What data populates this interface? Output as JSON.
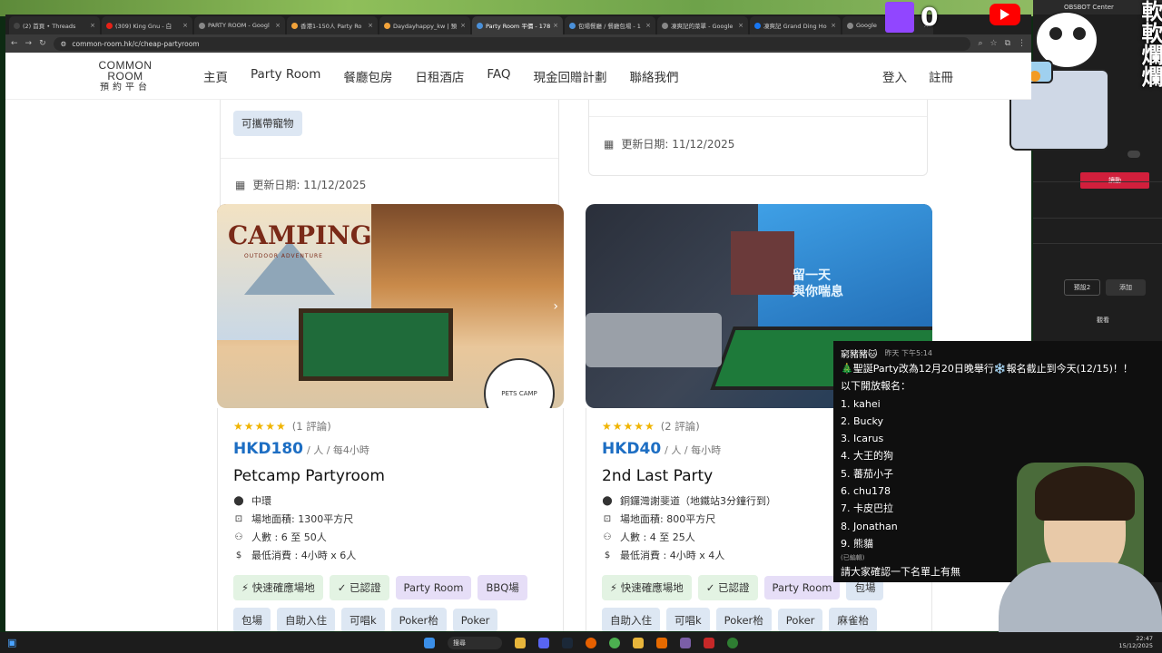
{
  "browser": {
    "tabs": [
      {
        "label": "(2) 首頁 • Threads",
        "color": "#444"
      },
      {
        "label": "(309) King Gnu - 白",
        "color": "#e62117"
      },
      {
        "label": "PARTY ROOM - Googl",
        "color": "#888"
      },
      {
        "label": "香港1-150人 Party Ro",
        "color": "#f2a33a"
      },
      {
        "label": "Daydayhappy_kw | 預",
        "color": "#f2a33a"
      },
      {
        "label": "Party Room 平價 - 178",
        "color": "#4a90d9"
      },
      {
        "label": "包場餐廳 / 餐廳包場 - 1",
        "color": "#4a90d9"
      },
      {
        "label": "凍爽記的菜單 - Google",
        "color": "#888"
      },
      {
        "label": "凍爽記 Grand Ding Ho",
        "color": "#1877f2"
      },
      {
        "label": "Google",
        "color": "#888"
      }
    ],
    "url": "common-room.hk/c/cheap-partyroom"
  },
  "site": {
    "logo_top": "COMMON ROOM",
    "logo_bottom": "預約平台",
    "menu": [
      "主頁",
      "Party Room",
      "餐廳包房",
      "日租酒店",
      "FAQ",
      "現金回贈計劃",
      "聯絡我們"
    ],
    "login": "登入",
    "register": "註冊"
  },
  "prev_cards": {
    "left_tag": "可攜帶寵物",
    "left_updated": "更新日期: 11/12/2025",
    "right_updated": "更新日期: 11/12/2025"
  },
  "cards": [
    {
      "image_text": "CAMPING",
      "image_subtext": "OUTDOOR ADVENTURE",
      "badge": "PETS CAMP",
      "stars": "★★★★★",
      "reviews": "(1 評論)",
      "price": "HKD180",
      "per": "/ 人 / 每4小時",
      "title": "Petcamp Partyroom",
      "location": "中環",
      "area": "場地面積: 1300平方尺",
      "people": "人數 : 6 至 50人",
      "min_spend": "最低消費 : 4小時 x 6人",
      "tags_row1": [
        {
          "label": "⚡ 快速確應場地",
          "style": "green"
        },
        {
          "label": "✓ 已認證",
          "style": "green"
        },
        {
          "label": "Party Room",
          "style": "purple"
        },
        {
          "label": "BBQ場",
          "style": "purple"
        }
      ],
      "tags_row2": [
        {
          "label": "包場",
          "style": "blue"
        },
        {
          "label": "自助入住",
          "style": "blue"
        },
        {
          "label": "可唱k",
          "style": "blue"
        },
        {
          "label": "Poker枱",
          "style": "blue"
        },
        {
          "label": "Poker",
          "style": "blue"
        }
      ]
    },
    {
      "image_text": "留一天 與你喘息",
      "stars": "★★★★★",
      "reviews": "(2 評論)",
      "price": "HKD40",
      "per": "/ 人 / 每小時",
      "title": "2nd Last Party",
      "location": "銅鑼灣謝斐道（地鐵站3分鐘行到）",
      "area": "場地面積: 800平方尺",
      "people": "人數 : 4 至 25人",
      "min_spend": "最低消費 : 4小時 x 4人",
      "tags_row1": [
        {
          "label": "⚡ 快速確應場地",
          "style": "green"
        },
        {
          "label": "✓ 已認證",
          "style": "green"
        },
        {
          "label": "Party Room",
          "style": "purple"
        },
        {
          "label": "包場",
          "style": "blue"
        }
      ],
      "tags_row2": [
        {
          "label": "自助入住",
          "style": "blue"
        },
        {
          "label": "可唱k",
          "style": "blue"
        },
        {
          "label": "Poker枱",
          "style": "blue"
        },
        {
          "label": "Poker",
          "style": "blue"
        },
        {
          "label": "麻雀枱",
          "style": "blue"
        }
      ]
    }
  ],
  "overlay": {
    "obs_title": "OBSBOT Center",
    "counter": "0",
    "side_text": "軟軟爛爛",
    "panel_button": "讀動",
    "preset": "預設2",
    "add": "添加",
    "small_label": "觀看"
  },
  "chat": {
    "user": "窮豬豬🐱",
    "time": "昨天 下午5:14",
    "lines": [
      "🎄聖誕Party改為12月20日晚舉行❄️報名截止到今天(12/15)！！",
      "以下開放報名：",
      "1. kahei",
      "2. Bucky",
      "3. Icarus",
      "4. 大王的狗",
      "5. 蕃茄小子",
      "6. chu178",
      "7. 卡皮巴拉",
      "8. Jonathan",
      "9. 熊貓"
    ],
    "edited": "(已編輯)",
    "footer": "請大家確認一下名單上有無"
  },
  "taskbar": {
    "time": "22:47",
    "date": "15/12/2025",
    "search": "搜尋"
  }
}
